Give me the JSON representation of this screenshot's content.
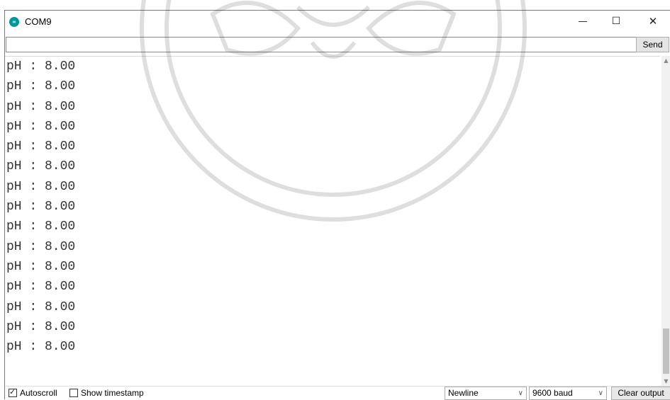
{
  "window": {
    "title": "COM9"
  },
  "send": {
    "input_value": "",
    "button_label": "Send"
  },
  "output_lines": [
    "pH : 8.00",
    "pH : 8.00",
    "pH : 8.00",
    "pH : 8.00",
    "pH : 8.00",
    "pH : 8.00",
    "pH : 8.00",
    "pH : 8.00",
    "pH : 8.00",
    "pH : 8.00",
    "pH : 8.00",
    "pH : 8.00",
    "pH : 8.00",
    "pH : 8.00",
    "pH : 8.00"
  ],
  "bottom": {
    "autoscroll_label": "Autoscroll",
    "autoscroll_checked": true,
    "timestamp_label": "Show timestamp",
    "timestamp_checked": false,
    "line_ending": "Newline",
    "baud_rate": "9600 baud",
    "clear_label": "Clear output"
  },
  "icons": {
    "app": "arduino-logo-icon",
    "minimize": "minimize-icon",
    "maximize": "maximize-icon",
    "close": "close-icon"
  },
  "colors": {
    "accent": "#00979c",
    "watermark": "#d6d6d6"
  }
}
